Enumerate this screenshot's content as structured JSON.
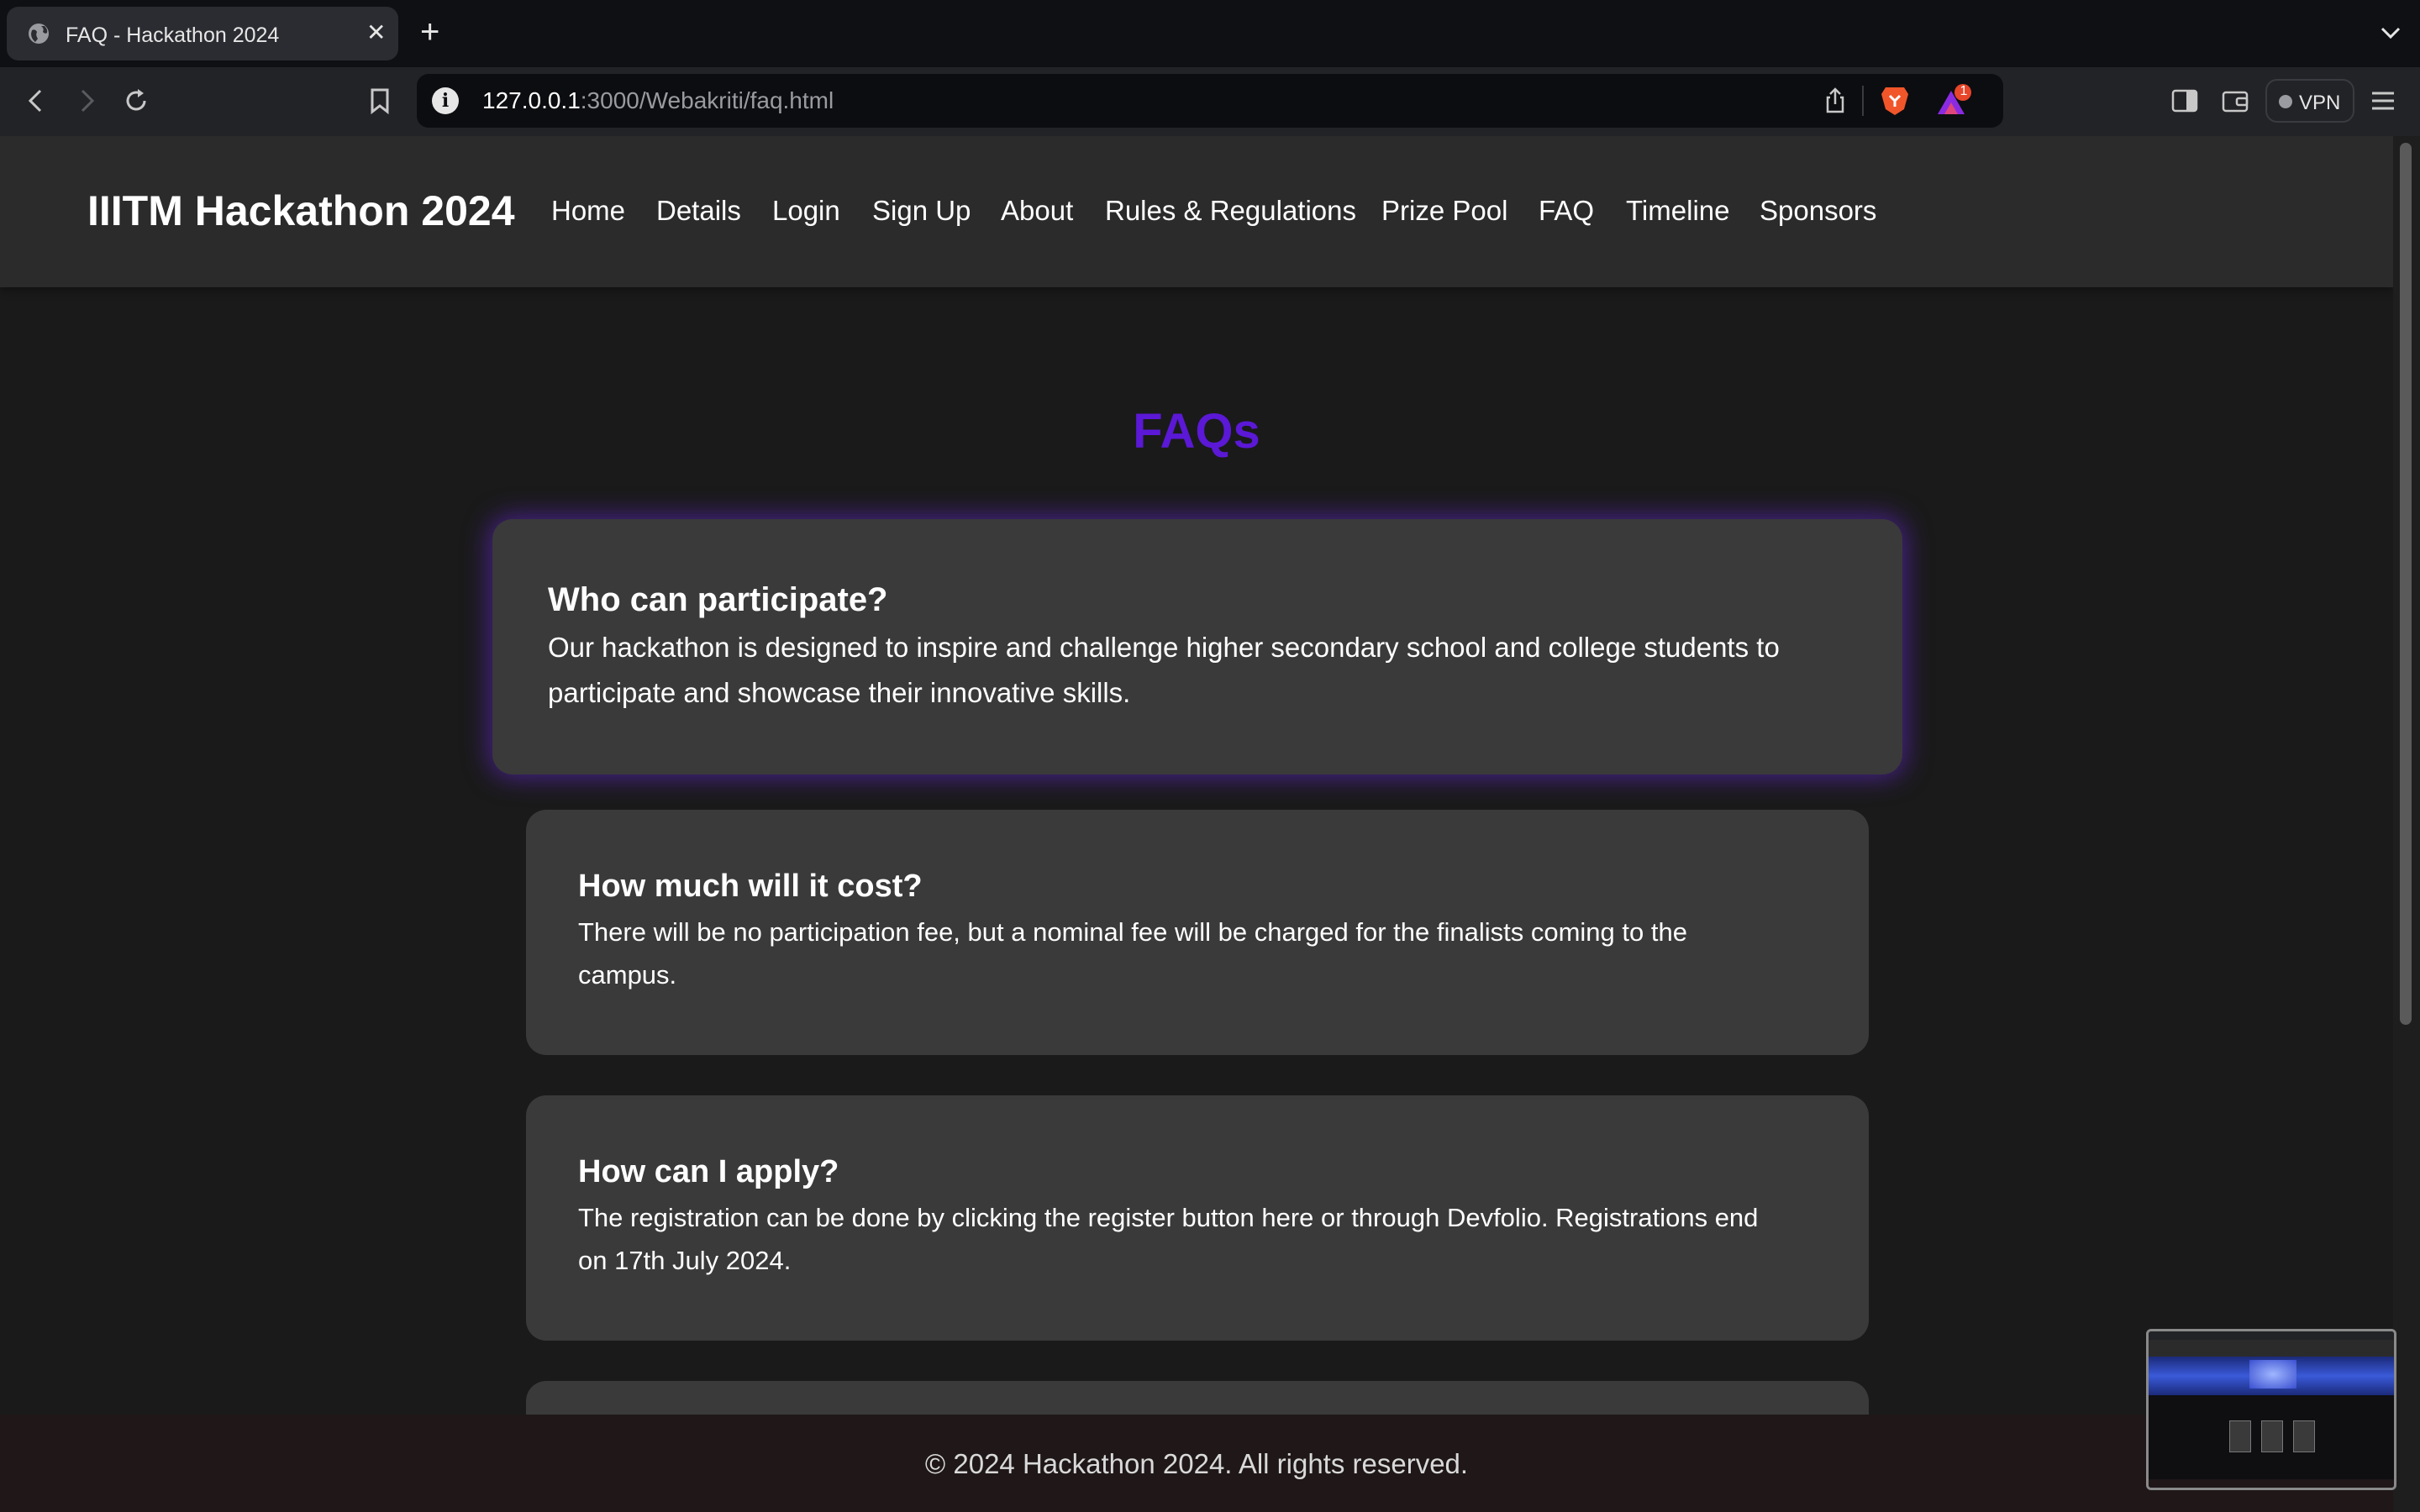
{
  "browser": {
    "tab_title": "FAQ - Hackathon 2024",
    "url_host": "127.0.0.1",
    "url_rest": ":3000/Webakriti/faq.html",
    "vpn_label": "VPN",
    "notification_count": "1"
  },
  "site": {
    "brand": "IIITM Hackathon 2024",
    "nav": [
      "Home",
      "Details",
      "Login",
      "Sign Up",
      "About",
      "Rules & Regulations",
      "Prize Pool",
      "FAQ",
      "Timeline",
      "Sponsors"
    ]
  },
  "faq": {
    "heading": "FAQs",
    "items": [
      {
        "question": "Who can participate?",
        "answer_line1": "Our hackathon is designed to inspire and challenge higher secondary school and college students to",
        "answer_line2": "participate and showcase their innovative skills."
      },
      {
        "question": "How much will it cost?",
        "answer_line1": "There will be no participation fee, but a nominal fee will be charged for the finalists coming to the",
        "answer_line2": "campus."
      },
      {
        "question": "How can I apply?",
        "answer_line1": "The registration can be done by clicking the register button here or through Devfolio. Registrations end",
        "answer_line2": "on 17th July 2024."
      }
    ]
  },
  "footer": {
    "text": "© 2024 Hackathon 2024. All rights reserved."
  },
  "colors": {
    "accent_purple": "#5b18d6",
    "card_bg": "#3a3a3a",
    "header_bg": "#2b2b2b",
    "page_bg": "#1a1a1a"
  },
  "icons": [
    "globe-icon",
    "close-icon",
    "plus-icon",
    "chevron-down-icon",
    "back-icon",
    "forward-icon",
    "reload-icon",
    "bookmark-icon",
    "info-icon",
    "share-icon",
    "brave-lion-icon",
    "brave-rewards-icon",
    "sidebar-icon",
    "wallet-icon",
    "menu-icon"
  ]
}
